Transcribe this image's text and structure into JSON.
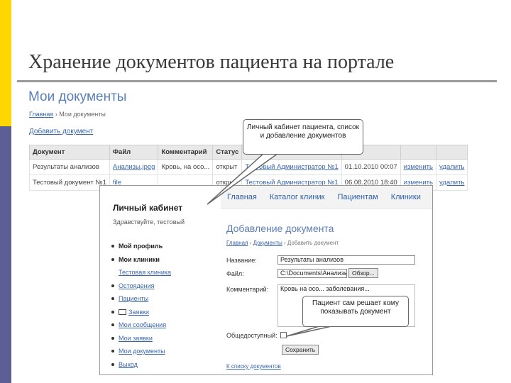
{
  "slide": {
    "title": "Хранение документов пациента на портале",
    "colors": {
      "strip_top": "#ffd700",
      "strip_bottom": "#5d5e94",
      "accent_title": "#5b7fb8"
    }
  },
  "back": {
    "heading": "Мои документы",
    "breadcrumb": {
      "home": "Главная",
      "sep": " › ",
      "current": "Мои документы"
    },
    "add_link": "Добавить документ",
    "columns": [
      "Документ",
      "Файл",
      "Комментарий",
      "Статус",
      "",
      "",
      "",
      ""
    ],
    "rows": [
      [
        "Результаты анализов",
        "Анализы.jpeg",
        "Кровь, на осо...",
        "открыт",
        "Тестовый Администратор №1",
        "01.10.2010 00:07",
        "изменить",
        "удалить"
      ],
      [
        "Тестовый документ №1",
        "file",
        "",
        "открыт",
        "Тестовый Администратор №1",
        "06.08.2010 18:40",
        "изменить",
        "удалить"
      ]
    ]
  },
  "front": {
    "nav": [
      "Главная",
      "Каталог клиник",
      "Пациентам",
      "Клиники"
    ],
    "sidebar_title": "Личный кабинет",
    "greeting": "Здравствуйте, тестовый",
    "menu": [
      {
        "label": "Мой профиль",
        "kind": "bold"
      },
      {
        "label": "Мои клиники",
        "kind": "bold"
      },
      {
        "label": "Тестовая клиника",
        "kind": "sub"
      },
      {
        "label": "Остоядения",
        "kind": "link"
      },
      {
        "label": "Пациенты",
        "kind": "link"
      },
      {
        "label": "Заявки",
        "kind": "link-icon"
      },
      {
        "label": "Мои сообщения",
        "kind": "link"
      },
      {
        "label": "Мои заявки",
        "kind": "link"
      },
      {
        "label": "Мои документы",
        "kind": "link"
      },
      {
        "label": "Выход",
        "kind": "link"
      }
    ],
    "form": {
      "heading": "Добавление документа",
      "breadcrumb": {
        "home": "Главная",
        "mid": "Документы",
        "current": "Добавить документ"
      },
      "name_label": "Название:",
      "name_value": "Результаты анализов",
      "file_label": "Файл:",
      "file_value": "C:\\Documents\\Анализы",
      "file_button": "Обзор...",
      "comment_label": "Комментарий:",
      "comment_value": "Кровь на осо... заболевания...",
      "shared_label": "Общедоступный:",
      "save_button": "Сохранить",
      "cancel_link": "К списку документов"
    }
  },
  "callouts": {
    "one": "Личный кабинет пациента, список и добавление документов",
    "two": "Пациент сам решает кому показывать документ"
  }
}
